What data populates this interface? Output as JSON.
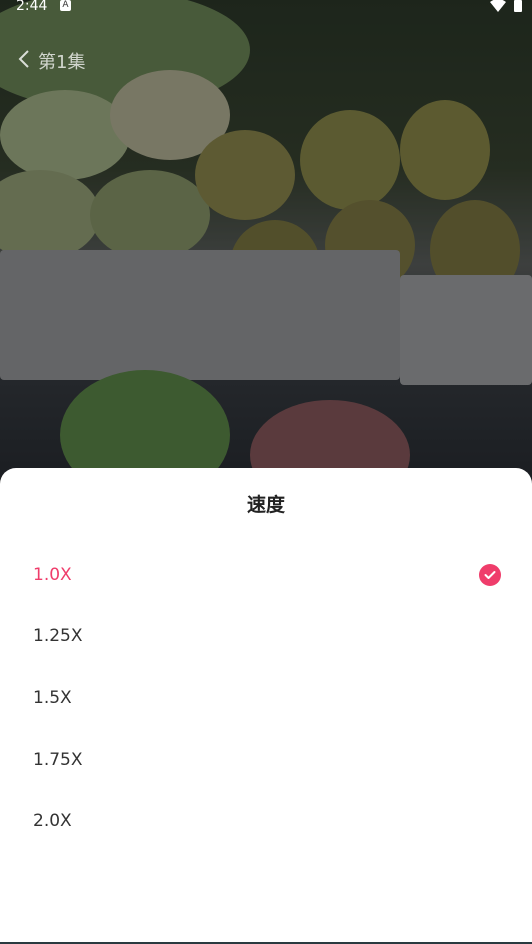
{
  "status_bar": {
    "time": "2:44",
    "notification_glyph": "A"
  },
  "header": {
    "episode_title": "第1集"
  },
  "sheet": {
    "title": "速度",
    "accent_color": "#ef3d6b",
    "options": [
      {
        "label": "1.0X",
        "selected": true
      },
      {
        "label": "1.25X",
        "selected": false
      },
      {
        "label": "1.5X",
        "selected": false
      },
      {
        "label": "1.75X",
        "selected": false
      },
      {
        "label": "2.0X",
        "selected": false
      }
    ]
  }
}
